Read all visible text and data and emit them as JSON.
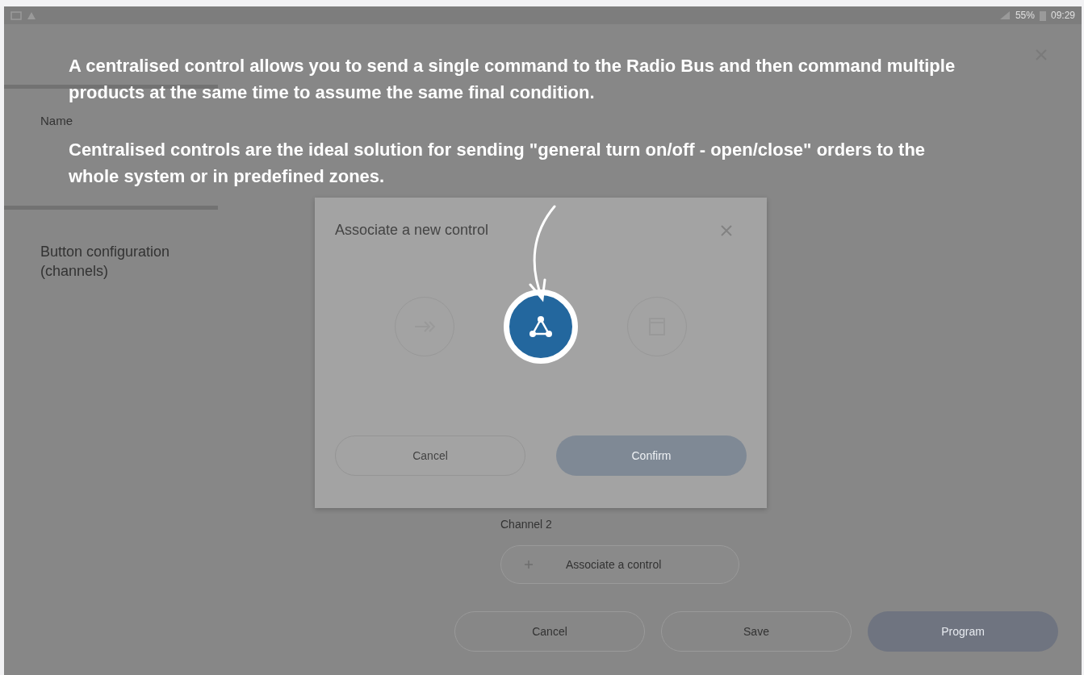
{
  "status_bar": {
    "battery": "55%",
    "time": "09:29"
  },
  "sidebar": {
    "items": [
      {
        "label": "Name"
      },
      {
        "label": "Button configuration (channels)"
      }
    ]
  },
  "annotation": {
    "paragraphs": [
      "A centralised control allows you to send a single command to the Radio Bus and then command multiple products at the same time to assume the same final condition.",
      "Centralised controls are the ideal solution for sending \"general turn on/off - open/close\" orders to the whole system or in predefined zones."
    ]
  },
  "dialog": {
    "title": "Associate a new control",
    "options": [
      {
        "kind": "arrow",
        "selected": false
      },
      {
        "kind": "network",
        "selected": true
      },
      {
        "kind": "window",
        "selected": false
      }
    ],
    "buttons": [
      {
        "label": "Cancel",
        "kind": "secondary"
      },
      {
        "label": "Confirm",
        "kind": "primary"
      }
    ]
  },
  "channel": {
    "label": "Channel 2",
    "button": "Associate a control"
  },
  "footer_buttons": [
    {
      "label": "Cancel",
      "kind": "secondary"
    },
    {
      "label": "Save",
      "kind": "secondary"
    },
    {
      "label": "Program",
      "kind": "primary"
    }
  ]
}
